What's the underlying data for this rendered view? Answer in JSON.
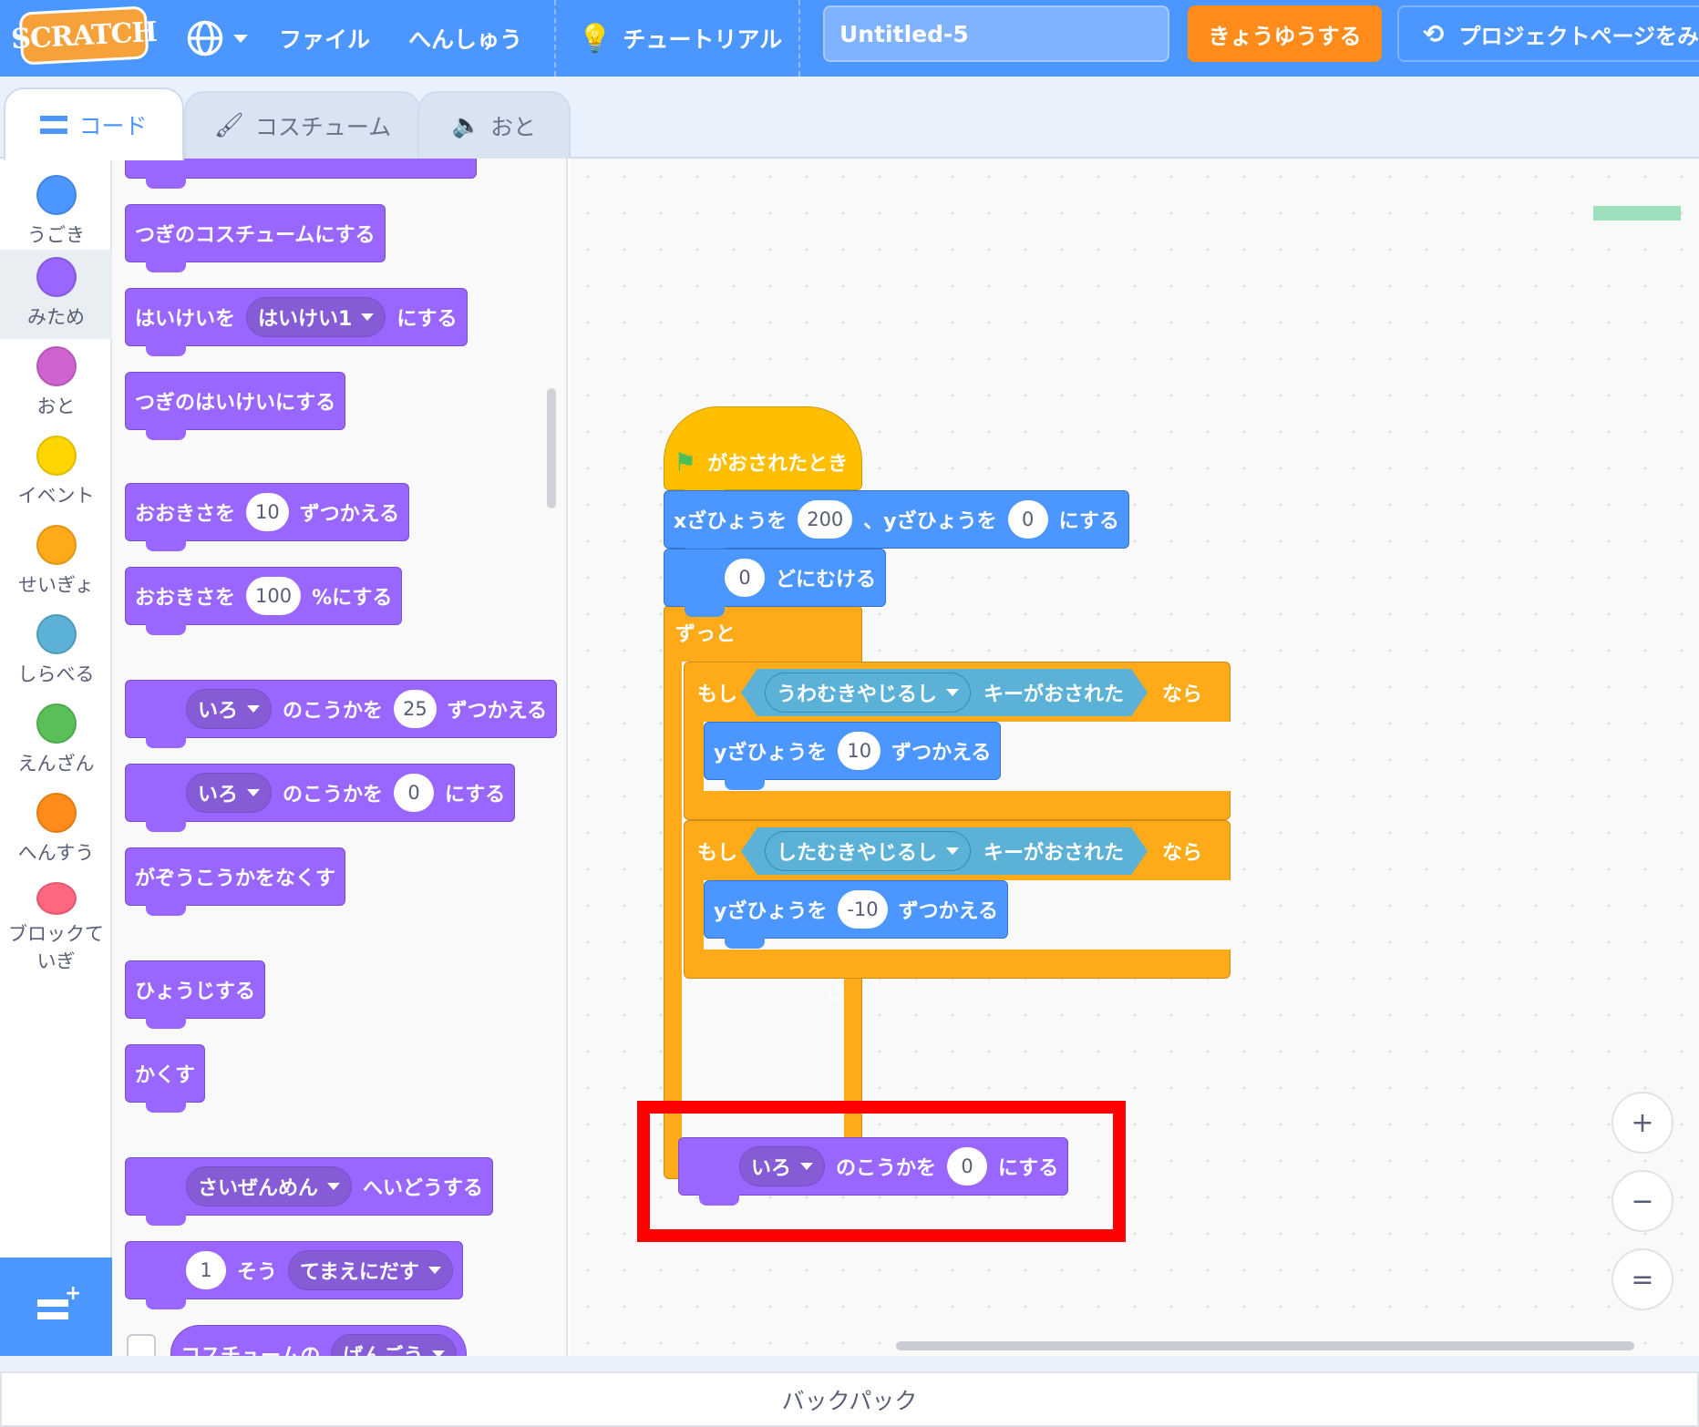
{
  "menu": {
    "logo": "SCRATCH",
    "file": "ファイル",
    "edit": "へんしゅう",
    "tutorials": "チュートリアル",
    "project_title": "Untitled-5",
    "share": "きょうゆうする",
    "see_project": "プロジェクトページをみ"
  },
  "tabs": {
    "code": "コード",
    "costumes": "コスチューム",
    "sounds": "おと"
  },
  "categories": [
    {
      "label": "うごき",
      "color": "#4c97ff"
    },
    {
      "label": "みため",
      "color": "#9966ff"
    },
    {
      "label": "おと",
      "color": "#cf63cf"
    },
    {
      "label": "イベント",
      "color": "#ffd500"
    },
    {
      "label": "せいぎょ",
      "color": "#ffab19"
    },
    {
      "label": "しらべる",
      "color": "#5cb1d6"
    },
    {
      "label": "えんざん",
      "color": "#59c059"
    },
    {
      "label": "へんすう",
      "color": "#ff8c1a"
    },
    {
      "label": "ブロックていぎ",
      "color": "#ff6680"
    }
  ],
  "palette": {
    "next_costume": "つぎのコスチュームにする",
    "switch_backdrop": {
      "pre": "はいけいを",
      "value": "はいけい1",
      "post": "にする"
    },
    "next_backdrop": "つぎのはいけいにする",
    "change_size": {
      "pre": "おおきさを",
      "value": "10",
      "post": "ずつかえる"
    },
    "set_size": {
      "pre": "おおきさを",
      "value": "100",
      "post": "%にする"
    },
    "change_effect": {
      "menu": "いろ",
      "mid": "のこうかを",
      "value": "25",
      "post": "ずつかえる"
    },
    "set_effect": {
      "menu": "いろ",
      "mid": "のこうかを",
      "value": "0",
      "post": "にする"
    },
    "clear_effects": "がぞうこうかをなくす",
    "show": "ひょうじする",
    "hide": "かくす",
    "go_to_layer": {
      "menu": "さいぜんめん",
      "post": "へいどうする"
    },
    "go_layers": {
      "value": "1",
      "mid": "そう",
      "menu": "てまえにだす"
    },
    "costume_reporter": {
      "pre": "コスチュームの",
      "menu": "ばんごう"
    }
  },
  "script": {
    "hat": "がおされたとき",
    "goto": {
      "pre": "xざひょうを",
      "x": "200",
      "mid": "、yざひょうを",
      "y": "0",
      "post": "にする"
    },
    "point": {
      "value": "0",
      "post": "どにむける"
    },
    "forever": "ずっと",
    "if1": {
      "pre": "もし",
      "key": "うわむきやじるし",
      "cond": "キーがおされた",
      "post": "なら"
    },
    "change_y1": {
      "pre": "yざひょうを",
      "value": "10",
      "post": "ずつかえる"
    },
    "if2": {
      "pre": "もし",
      "key": "したむきやじるし",
      "cond": "キーがおされた",
      "post": "なら"
    },
    "change_y2": {
      "pre": "yざひょうを",
      "value": "-10",
      "post": "ずつかえる"
    },
    "loop_arrow": "↺"
  },
  "highlighted_block": {
    "menu": "いろ",
    "mid": "のこうかを",
    "value": "0",
    "post": "にする"
  },
  "zoom": {
    "in": "+",
    "out": "−",
    "reset": "="
  },
  "backpack": "バックパック"
}
